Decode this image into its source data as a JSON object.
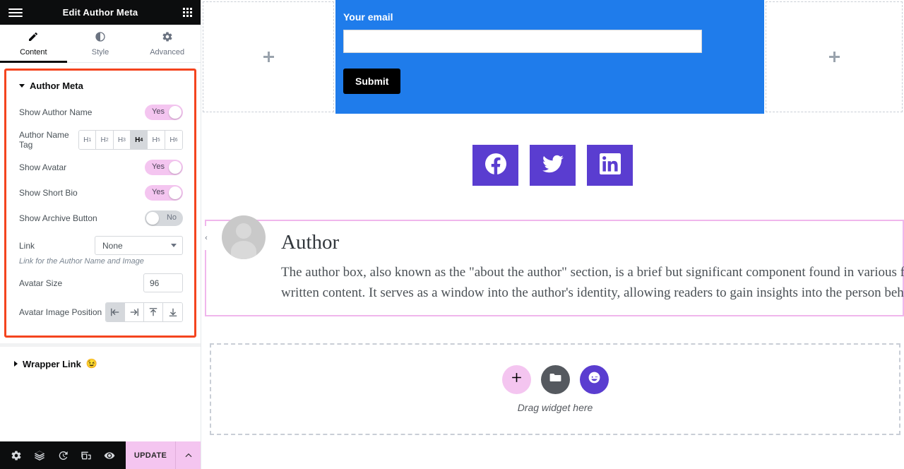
{
  "panel": {
    "header": {
      "title": "Edit Author Meta",
      "menu_icon": "hamburger-icon",
      "apps_icon": "apps-grid-icon"
    },
    "tabs": [
      {
        "label": "Content",
        "icon": "pencil-icon",
        "active": true
      },
      {
        "label": "Style",
        "icon": "contrast-icon",
        "active": false
      },
      {
        "label": "Advanced",
        "icon": "gear-icon",
        "active": false
      }
    ],
    "section": {
      "title": "Author Meta",
      "expanded": true,
      "highlight_color": "#f4441e",
      "controls": [
        {
          "label": "Show Author Name",
          "type": "toggle",
          "value": "Yes",
          "on": true
        },
        {
          "label": "Author Name Tag",
          "type": "choices",
          "options": [
            "H1",
            "H2",
            "H3",
            "H4",
            "H5",
            "H6"
          ],
          "selected": "H4"
        },
        {
          "label": "Show Avatar",
          "type": "toggle",
          "value": "Yes",
          "on": true
        },
        {
          "label": "Show Short Bio",
          "type": "toggle",
          "value": "Yes",
          "on": true
        },
        {
          "label": "Show Archive Button",
          "type": "toggle",
          "value": "No",
          "on": false
        },
        {
          "label": "Link",
          "type": "select",
          "value": "None",
          "note": "Link for the Author Name and Image"
        },
        {
          "label": "Avatar Size",
          "type": "number",
          "value": "96"
        },
        {
          "label": "Avatar Image Position",
          "type": "icon-group",
          "options": [
            "align-left",
            "align-right",
            "align-top",
            "align-bottom"
          ],
          "selected": "align-left"
        }
      ]
    },
    "wrapper_section": {
      "title": "Wrapper Link",
      "emoji": "😉",
      "expanded": false
    },
    "footer": {
      "icons": [
        "settings-gear-icon",
        "layers-icon",
        "history-icon",
        "responsive-devices-icon",
        "preview-eye-icon"
      ],
      "update_label": "UPDATE",
      "update_color": "#f4c5f0",
      "caret_icon": "chevron-up-icon"
    }
  },
  "canvas": {
    "collapse_handle_icon": "chevron-left-icon",
    "placeholder_left": {
      "icon": "plus-icon"
    },
    "placeholder_right": {
      "icon": "plus-icon"
    },
    "form": {
      "background": "#1f7ceb",
      "label": "Your email",
      "input_value": "",
      "input_placeholder": "",
      "submit_label": "Submit"
    },
    "socials": {
      "background": "#5a3dd0",
      "items": [
        {
          "name": "facebook-icon",
          "label": "Facebook"
        },
        {
          "name": "twitter-icon",
          "label": "Twitter"
        },
        {
          "name": "linkedin-icon",
          "label": "LinkedIn"
        }
      ]
    },
    "author_box": {
      "outline_color": "#f0b6ec",
      "avatar_icon": "default-avatar-icon",
      "name": "Author",
      "bio": "The author box, also known as the \"about the author\" section, is a brief but significant component found in various forms of written content. It serves as a window into the author's identity, allowing readers to gain insights into the person behind the words."
    },
    "drop_zone": {
      "text": "Drag widget here",
      "buttons": [
        {
          "name": "add-widget-button",
          "icon": "plus-icon",
          "color": "#f4c5f0"
        },
        {
          "name": "folder-templates-button",
          "icon": "folder-icon",
          "color": "#55595f"
        },
        {
          "name": "ai-button",
          "icon": "wink-face-icon",
          "color": "#5a3dd0"
        }
      ]
    }
  }
}
